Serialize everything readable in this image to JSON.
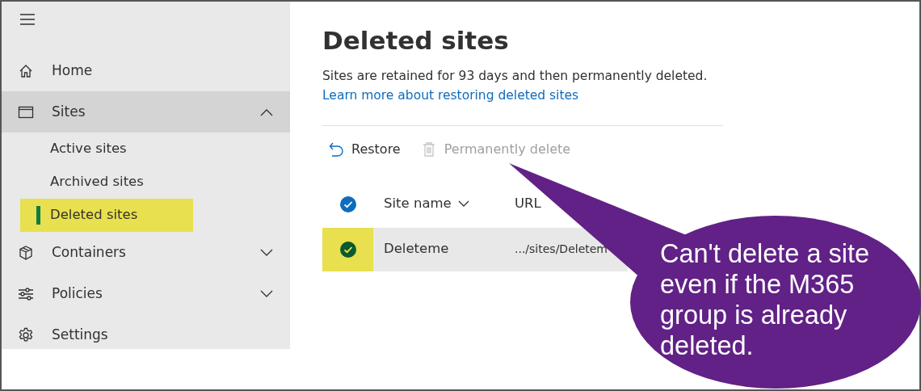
{
  "nav": {
    "items": [
      {
        "kind": "home",
        "label": "Home",
        "selected": false
      },
      {
        "kind": "sites",
        "label": "Sites",
        "selected": true,
        "expanded": true,
        "children": [
          {
            "label": "Active sites",
            "selected": false,
            "highlighted": false
          },
          {
            "label": "Archived sites",
            "selected": false,
            "highlighted": false
          },
          {
            "label": "Deleted sites",
            "selected": true,
            "highlighted": true
          }
        ]
      },
      {
        "kind": "containers",
        "label": "Containers",
        "selected": false,
        "expanded": false
      },
      {
        "kind": "policies",
        "label": "Policies",
        "selected": false,
        "expanded": false
      },
      {
        "kind": "settings",
        "label": "Settings",
        "selected": false
      }
    ]
  },
  "page": {
    "title": "Deleted sites",
    "description": "Sites are retained for 93 days and then permanently deleted.",
    "link": "Learn more about restoring deleted sites"
  },
  "toolbar": [
    {
      "kind": "restore",
      "label": "Restore",
      "disabled": false
    },
    {
      "kind": "delete",
      "label": "Permanently delete",
      "disabled": true
    }
  ],
  "table": {
    "select_all": {
      "checked": true
    },
    "columns": [
      "Site name",
      "URL"
    ],
    "rows": [
      {
        "selected": true,
        "highlighted": true,
        "cells": [
          "Deleteme",
          ".../sites/Deletem"
        ]
      }
    ]
  },
  "callout": {
    "text": "Can't delete a site even if the M365 group is already deleted."
  }
}
